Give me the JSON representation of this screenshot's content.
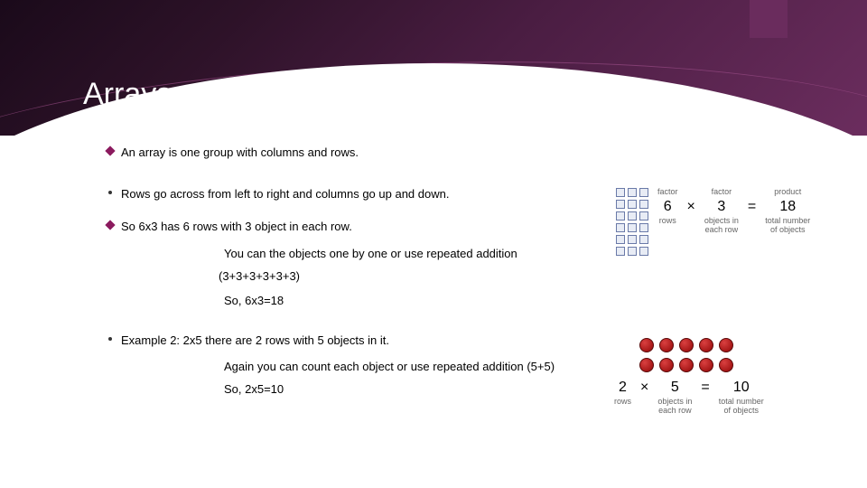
{
  "title": "Arrays",
  "bullets": {
    "b1": "An array is one group with columns and rows.",
    "b2": "Rows go across from left to right and columns go up and down.",
    "b3": "So 6x3 has 6 rows with 3 object in each row.",
    "b3a": "You can the objects one by one or use repeated addition",
    "b3b": "(3+3+3+3+3+3)",
    "b3c": "So, 6x3=18",
    "b4": "Example 2:  2x5 there are 2 rows with 5 objects in it.",
    "b4a": "Again you can count each object or use repeated addition (5+5)",
    "b4b": "So, 2x5=10"
  },
  "fig1": {
    "factor1": "6",
    "factor1_label": "rows",
    "factor1_top": "factor",
    "op": "×",
    "factor2": "3",
    "factor2_label": "objects in\neach row",
    "factor2_top": "factor",
    "eq": "=",
    "product": "18",
    "product_label": "total number\nof objects",
    "product_top": "product"
  },
  "fig2": {
    "factor1": "2",
    "factor1_label": "rows",
    "op": "×",
    "factor2": "5",
    "factor2_label": "objects in\neach row",
    "eq": "=",
    "product": "10",
    "product_label": "total number\nof objects"
  }
}
